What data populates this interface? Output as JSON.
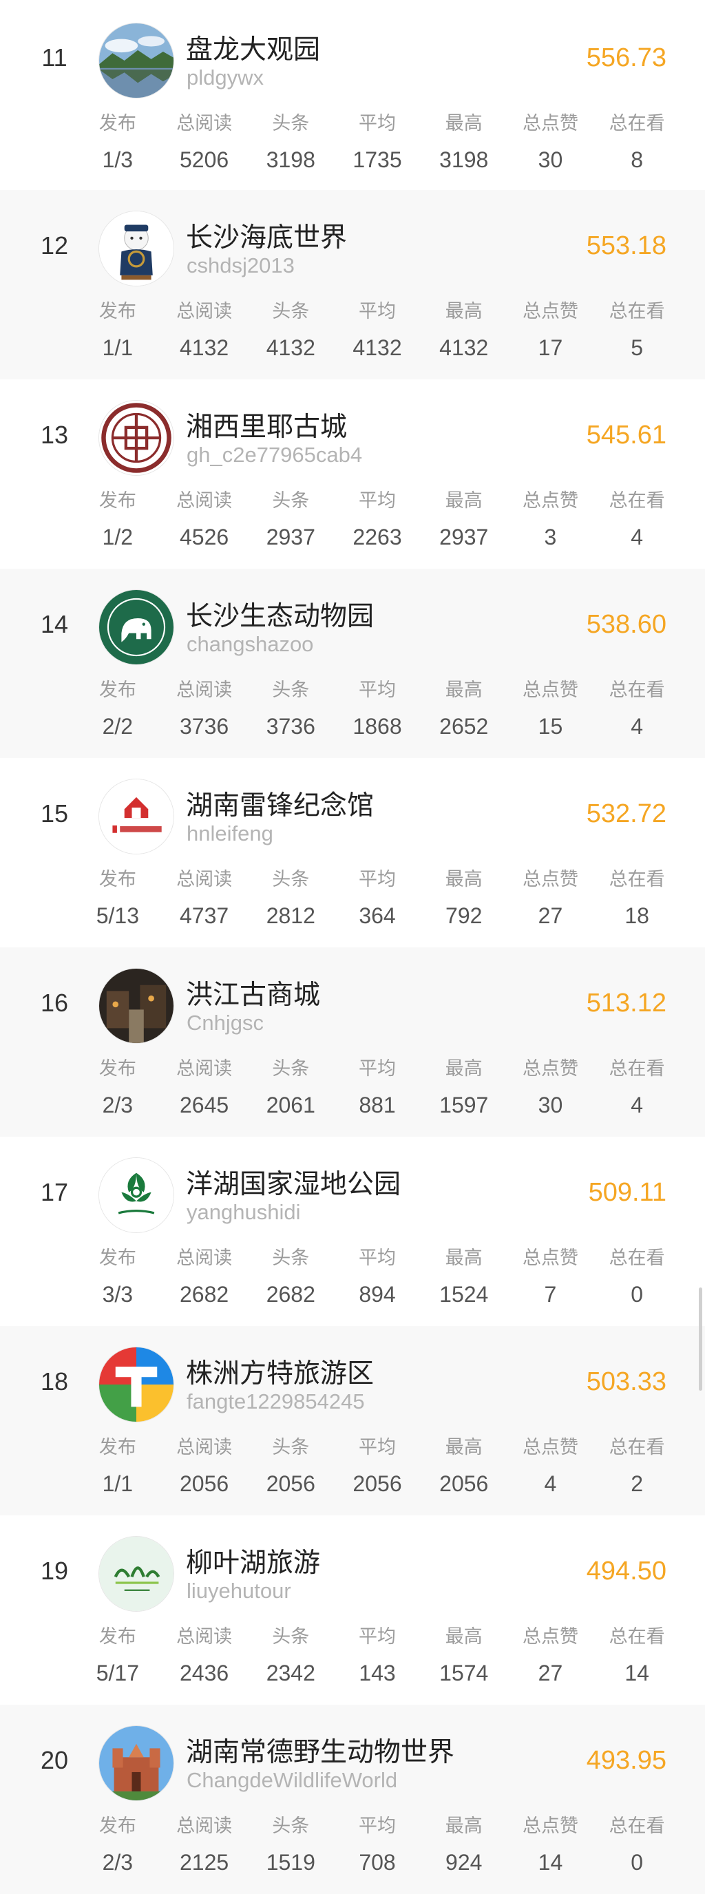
{
  "colors": {
    "score": "#f5a623",
    "row_alt_bg": "#f8f8f8",
    "label": "#9b9b9b",
    "value": "#555555"
  },
  "stat_labels": [
    "发布",
    "总阅读",
    "头条",
    "平均",
    "最高",
    "总点赞",
    "总在看"
  ],
  "rows": [
    {
      "rank": "11",
      "name": "盘龙大观园",
      "handle": "pldgywx",
      "score": "556.73",
      "avatar_icon": "landscape-lake-icon",
      "stats": [
        "1/3",
        "5206",
        "3198",
        "1735",
        "3198",
        "30",
        "8"
      ]
    },
    {
      "rank": "12",
      "name": "长沙海底世界",
      "handle": "cshdsj2013",
      "score": "553.18",
      "avatar_icon": "captain-bear-icon",
      "stats": [
        "1/1",
        "4132",
        "4132",
        "4132",
        "4132",
        "17",
        "5"
      ]
    },
    {
      "rank": "13",
      "name": "湘西里耶古城",
      "handle": "gh_c2e77965cab4",
      "score": "545.61",
      "avatar_icon": "ornamental-seal-icon",
      "stats": [
        "1/2",
        "4526",
        "2937",
        "2263",
        "2937",
        "3",
        "4"
      ]
    },
    {
      "rank": "14",
      "name": "长沙生态动物园",
      "handle": "changshazoo",
      "score": "538.60",
      "avatar_icon": "elephant-badge-icon",
      "stats": [
        "2/2",
        "3736",
        "3736",
        "1868",
        "2652",
        "15",
        "4"
      ]
    },
    {
      "rank": "15",
      "name": "湖南雷锋纪念馆",
      "handle": "hnleifeng",
      "score": "532.72",
      "avatar_icon": "memorial-logo-icon",
      "stats": [
        "5/13",
        "4737",
        "2812",
        "364",
        "792",
        "27",
        "18"
      ]
    },
    {
      "rank": "16",
      "name": "洪江古商城",
      "handle": "Cnhjgsc",
      "score": "513.12",
      "avatar_icon": "old-town-photo-icon",
      "stats": [
        "2/3",
        "2645",
        "2061",
        "881",
        "1597",
        "30",
        "4"
      ]
    },
    {
      "rank": "17",
      "name": "洋湖国家湿地公园",
      "handle": "yanghushidi",
      "score": "509.11",
      "avatar_icon": "wetland-leaf-icon",
      "stats": [
        "3/3",
        "2682",
        "2682",
        "894",
        "1524",
        "7",
        "0"
      ]
    },
    {
      "rank": "18",
      "name": "株洲方特旅游区",
      "handle": "fangte1229854245",
      "score": "503.33",
      "avatar_icon": "fangte-t-logo-icon",
      "stats": [
        "1/1",
        "2056",
        "2056",
        "2056",
        "2056",
        "4",
        "2"
      ]
    },
    {
      "rank": "19",
      "name": "柳叶湖旅游",
      "handle": "liuyehutour",
      "score": "494.50",
      "avatar_icon": "liuyehu-logo-icon",
      "stats": [
        "5/17",
        "2436",
        "2342",
        "143",
        "1574",
        "27",
        "14"
      ]
    },
    {
      "rank": "20",
      "name": "湖南常德野生动物世界",
      "handle": "ChangdeWildlifeWorld",
      "score": "493.95",
      "avatar_icon": "castle-photo-icon",
      "stats": [
        "2/3",
        "2125",
        "1519",
        "708",
        "924",
        "14",
        "0"
      ]
    }
  ]
}
